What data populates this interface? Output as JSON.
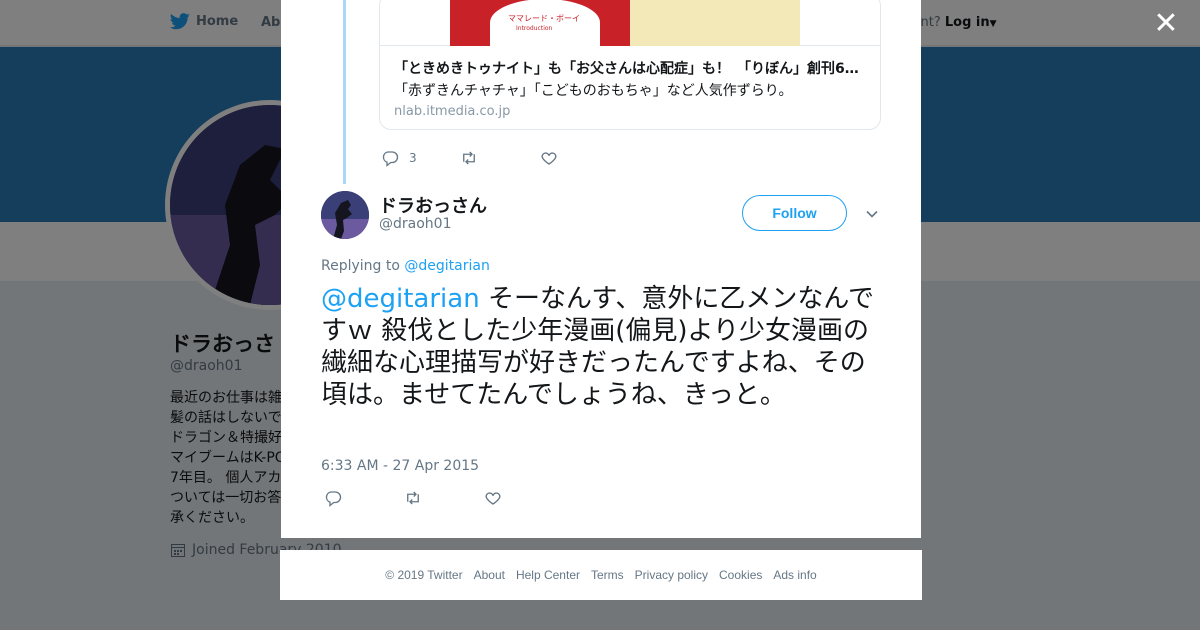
{
  "topbar": {
    "home_label": "Home",
    "about_label": "Abo",
    "account_prompt": "ccount?",
    "login_label": "Log in"
  },
  "profile": {
    "name": "ドラおっさ",
    "handle": "@draoh01",
    "bio_lines": [
      "最近のお仕事は雑",
      "髪の話はしないで",
      "ドラゴン＆特撮好",
      "マイブームはK-PO",
      "7年目。 個人アカ",
      "ついては一切お答",
      "承ください。"
    ],
    "joined": "Joined February 2010"
  },
  "modal": {
    "card": {
      "image_caption_jp": "ママレード・ボーイ",
      "image_caption_en": "Introduction",
      "title": "「ときめきトゥナイト」も「お父さんは心配症」も！　「りぼん」創刊6…",
      "description": "「赤ずきんチャチャ」「こどものおもちゃ」など人気作ずらり。",
      "domain": "nlab.itmedia.co.jp"
    },
    "parent_actions": {
      "reply_count": "3",
      "retweet_count": "",
      "like_count": ""
    },
    "author": {
      "name": "ドラおっさん",
      "handle": "@draoh01"
    },
    "follow_label": "Follow",
    "replying_prefix": "Replying to",
    "replying_handle": "@degitarian",
    "tweet_mention": "@degitarian",
    "tweet_body": " そーなんす、意外に乙メンなんですｗ 殺伐とした少年漫画(偏見)より少女漫画の繊細な心理描写が好きだったんですよね、その頃は。ませてたんでしょうね、きっと。",
    "timestamp": "6:33 AM - 27 Apr 2015"
  },
  "footer": {
    "links": [
      "© 2019 Twitter",
      "About",
      "Help Center",
      "Terms",
      "Privacy policy",
      "Cookies",
      "Ads info"
    ]
  },
  "colors": {
    "accent": "#1da1f2",
    "banner": "#2b7bb9",
    "thread_line": "#a8d8f5"
  },
  "icons": [
    "twitter-bird-icon",
    "close-icon",
    "reply-icon",
    "retweet-icon",
    "like-icon",
    "chevron-down-icon",
    "calendar-icon"
  ]
}
